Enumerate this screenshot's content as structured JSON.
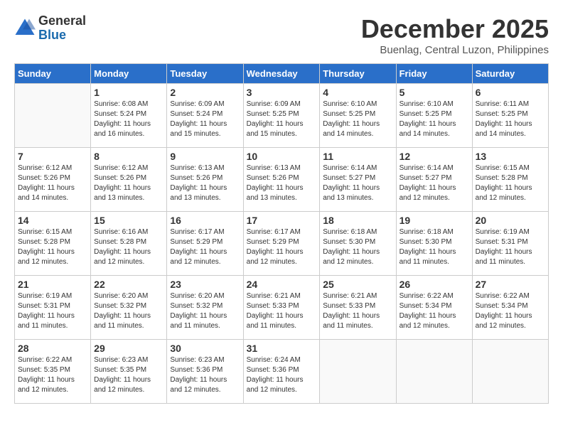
{
  "logo": {
    "general": "General",
    "blue": "Blue"
  },
  "title": "December 2025",
  "location": "Buenlag, Central Luzon, Philippines",
  "days_header": [
    "Sunday",
    "Monday",
    "Tuesday",
    "Wednesday",
    "Thursday",
    "Friday",
    "Saturday"
  ],
  "weeks": [
    [
      {
        "day": "",
        "info": ""
      },
      {
        "day": "1",
        "info": "Sunrise: 6:08 AM\nSunset: 5:24 PM\nDaylight: 11 hours\nand 16 minutes."
      },
      {
        "day": "2",
        "info": "Sunrise: 6:09 AM\nSunset: 5:24 PM\nDaylight: 11 hours\nand 15 minutes."
      },
      {
        "day": "3",
        "info": "Sunrise: 6:09 AM\nSunset: 5:25 PM\nDaylight: 11 hours\nand 15 minutes."
      },
      {
        "day": "4",
        "info": "Sunrise: 6:10 AM\nSunset: 5:25 PM\nDaylight: 11 hours\nand 14 minutes."
      },
      {
        "day": "5",
        "info": "Sunrise: 6:10 AM\nSunset: 5:25 PM\nDaylight: 11 hours\nand 14 minutes."
      },
      {
        "day": "6",
        "info": "Sunrise: 6:11 AM\nSunset: 5:25 PM\nDaylight: 11 hours\nand 14 minutes."
      }
    ],
    [
      {
        "day": "7",
        "info": "Sunrise: 6:12 AM\nSunset: 5:26 PM\nDaylight: 11 hours\nand 14 minutes."
      },
      {
        "day": "8",
        "info": "Sunrise: 6:12 AM\nSunset: 5:26 PM\nDaylight: 11 hours\nand 13 minutes."
      },
      {
        "day": "9",
        "info": "Sunrise: 6:13 AM\nSunset: 5:26 PM\nDaylight: 11 hours\nand 13 minutes."
      },
      {
        "day": "10",
        "info": "Sunrise: 6:13 AM\nSunset: 5:26 PM\nDaylight: 11 hours\nand 13 minutes."
      },
      {
        "day": "11",
        "info": "Sunrise: 6:14 AM\nSunset: 5:27 PM\nDaylight: 11 hours\nand 13 minutes."
      },
      {
        "day": "12",
        "info": "Sunrise: 6:14 AM\nSunset: 5:27 PM\nDaylight: 11 hours\nand 12 minutes."
      },
      {
        "day": "13",
        "info": "Sunrise: 6:15 AM\nSunset: 5:28 PM\nDaylight: 11 hours\nand 12 minutes."
      }
    ],
    [
      {
        "day": "14",
        "info": "Sunrise: 6:15 AM\nSunset: 5:28 PM\nDaylight: 11 hours\nand 12 minutes."
      },
      {
        "day": "15",
        "info": "Sunrise: 6:16 AM\nSunset: 5:28 PM\nDaylight: 11 hours\nand 12 minutes."
      },
      {
        "day": "16",
        "info": "Sunrise: 6:17 AM\nSunset: 5:29 PM\nDaylight: 11 hours\nand 12 minutes."
      },
      {
        "day": "17",
        "info": "Sunrise: 6:17 AM\nSunset: 5:29 PM\nDaylight: 11 hours\nand 12 minutes."
      },
      {
        "day": "18",
        "info": "Sunrise: 6:18 AM\nSunset: 5:30 PM\nDaylight: 11 hours\nand 12 minutes."
      },
      {
        "day": "19",
        "info": "Sunrise: 6:18 AM\nSunset: 5:30 PM\nDaylight: 11 hours\nand 11 minutes."
      },
      {
        "day": "20",
        "info": "Sunrise: 6:19 AM\nSunset: 5:31 PM\nDaylight: 11 hours\nand 11 minutes."
      }
    ],
    [
      {
        "day": "21",
        "info": "Sunrise: 6:19 AM\nSunset: 5:31 PM\nDaylight: 11 hours\nand 11 minutes."
      },
      {
        "day": "22",
        "info": "Sunrise: 6:20 AM\nSunset: 5:32 PM\nDaylight: 11 hours\nand 11 minutes."
      },
      {
        "day": "23",
        "info": "Sunrise: 6:20 AM\nSunset: 5:32 PM\nDaylight: 11 hours\nand 11 minutes."
      },
      {
        "day": "24",
        "info": "Sunrise: 6:21 AM\nSunset: 5:33 PM\nDaylight: 11 hours\nand 11 minutes."
      },
      {
        "day": "25",
        "info": "Sunrise: 6:21 AM\nSunset: 5:33 PM\nDaylight: 11 hours\nand 11 minutes."
      },
      {
        "day": "26",
        "info": "Sunrise: 6:22 AM\nSunset: 5:34 PM\nDaylight: 11 hours\nand 12 minutes."
      },
      {
        "day": "27",
        "info": "Sunrise: 6:22 AM\nSunset: 5:34 PM\nDaylight: 11 hours\nand 12 minutes."
      }
    ],
    [
      {
        "day": "28",
        "info": "Sunrise: 6:22 AM\nSunset: 5:35 PM\nDaylight: 11 hours\nand 12 minutes."
      },
      {
        "day": "29",
        "info": "Sunrise: 6:23 AM\nSunset: 5:35 PM\nDaylight: 11 hours\nand 12 minutes."
      },
      {
        "day": "30",
        "info": "Sunrise: 6:23 AM\nSunset: 5:36 PM\nDaylight: 11 hours\nand 12 minutes."
      },
      {
        "day": "31",
        "info": "Sunrise: 6:24 AM\nSunset: 5:36 PM\nDaylight: 11 hours\nand 12 minutes."
      },
      {
        "day": "",
        "info": ""
      },
      {
        "day": "",
        "info": ""
      },
      {
        "day": "",
        "info": ""
      }
    ]
  ]
}
